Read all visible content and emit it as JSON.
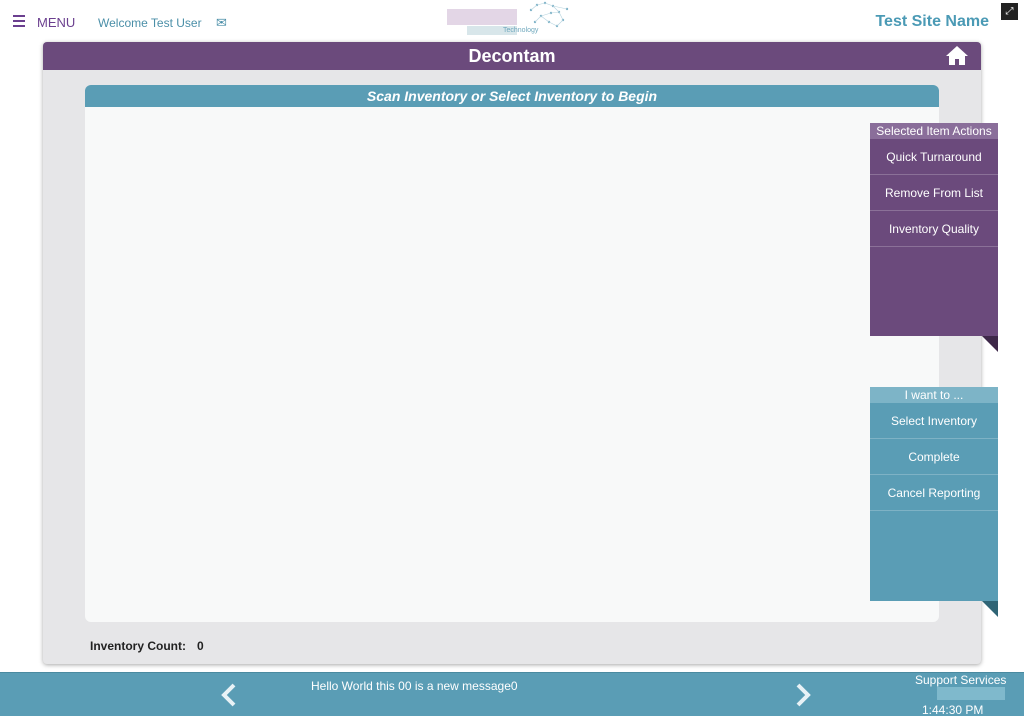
{
  "header": {
    "menu_label": "MENU",
    "welcome": "Welcome Test User",
    "logo_text": "Technology",
    "site_name": "Test Site Name"
  },
  "panel": {
    "title": "Decontam",
    "subheader": "Scan Inventory or Select Inventory to Begin",
    "count_label": "Inventory Count:",
    "count_value": "0"
  },
  "selected_actions": {
    "header": "Selected Item Actions",
    "items": [
      "Quick Turnaround",
      "Remove From List",
      "Inventory Quality"
    ]
  },
  "want_actions": {
    "header": "I want to ...",
    "items": [
      "Select Inventory",
      "Complete",
      "Cancel Reporting"
    ]
  },
  "footer": {
    "message": "Hello World this 00 is a new message0",
    "support": "Support Services",
    "time": "1:44:30 PM"
  },
  "colors": {
    "purple": "#6b4a7c",
    "teal": "#5a9db5"
  }
}
